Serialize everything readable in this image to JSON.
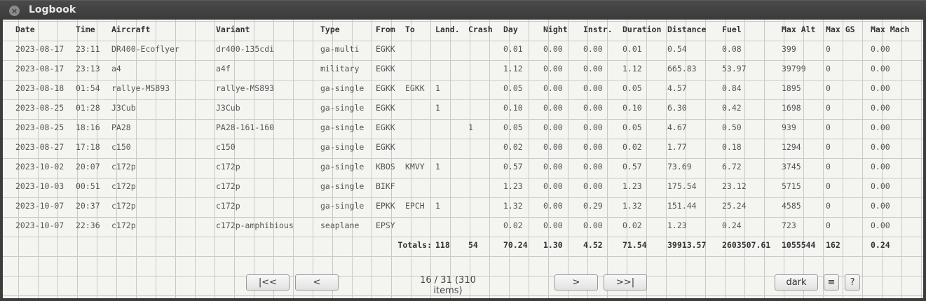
{
  "window": {
    "title": "Logbook"
  },
  "columns": [
    "Date",
    "Time",
    "Aircraft",
    "Variant",
    "Type",
    "From",
    "To",
    "Land.",
    "Crash",
    "Day",
    "Night",
    "Instr.",
    "Duration",
    "Distance",
    "Fuel",
    "Max Alt",
    "Max GS",
    "Max Mach"
  ],
  "rows": [
    [
      "2023-08-17",
      "23:11",
      "DR400-Ecoflyer",
      "dr400-135cdi",
      "ga-multi",
      "EGKK",
      "",
      "",
      "",
      "0.01",
      "0.00",
      "0.00",
      "0.01",
      "0.54",
      "0.08",
      "399",
      "0",
      "0.00"
    ],
    [
      "2023-08-17",
      "23:13",
      "a4",
      "a4f",
      "military",
      "EGKK",
      "",
      "",
      "",
      "1.12",
      "0.00",
      "0.00",
      "1.12",
      "665.83",
      "53.97",
      "39799",
      "0",
      "0.00"
    ],
    [
      "2023-08-18",
      "01:54",
      "rallye-MS893",
      "rallye-MS893",
      "ga-single",
      "EGKK",
      "EGKK",
      "1",
      "",
      "0.05",
      "0.00",
      "0.00",
      "0.05",
      "4.57",
      "0.84",
      "1895",
      "0",
      "0.00"
    ],
    [
      "2023-08-25",
      "01:28",
      "J3Cub",
      "J3Cub",
      "ga-single",
      "EGKK",
      "",
      "1",
      "",
      "0.10",
      "0.00",
      "0.00",
      "0.10",
      "6.30",
      "0.42",
      "1698",
      "0",
      "0.00"
    ],
    [
      "2023-08-25",
      "18:16",
      "PA28",
      "PA28-161-160",
      "ga-single",
      "EGKK",
      "",
      "",
      "1",
      "0.05",
      "0.00",
      "0.00",
      "0.05",
      "4.67",
      "0.50",
      "939",
      "0",
      "0.00"
    ],
    [
      "2023-08-27",
      "17:18",
      "c150",
      "c150",
      "ga-single",
      "EGKK",
      "",
      "",
      "",
      "0.02",
      "0.00",
      "0.00",
      "0.02",
      "1.77",
      "0.18",
      "1294",
      "0",
      "0.00"
    ],
    [
      "2023-10-02",
      "20:07",
      "c172p",
      "c172p",
      "ga-single",
      "KBOS",
      "KMVY",
      "1",
      "",
      "0.57",
      "0.00",
      "0.00",
      "0.57",
      "73.69",
      "6.72",
      "3745",
      "0",
      "0.00"
    ],
    [
      "2023-10-03",
      "00:51",
      "c172p",
      "c172p",
      "ga-single",
      "BIKF",
      "",
      "",
      "",
      "1.23",
      "0.00",
      "0.00",
      "1.23",
      "175.54",
      "23.12",
      "5715",
      "0",
      "0.00"
    ],
    [
      "2023-10-07",
      "20:37",
      "c172p",
      "c172p",
      "ga-single",
      "EPKK",
      "EPCH",
      "1",
      "",
      "1.32",
      "0.00",
      "0.29",
      "1.32",
      "151.44",
      "25.24",
      "4585",
      "0",
      "0.00"
    ],
    [
      "2023-10-07",
      "22:36",
      "c172p",
      "c172p-amphibious",
      "seaplane",
      "EPSY",
      "",
      "",
      "",
      "0.02",
      "0.00",
      "0.00",
      "0.02",
      "1.23",
      "0.24",
      "723",
      "0",
      "0.00"
    ]
  ],
  "totals": {
    "label": "Totals:",
    "land": "118",
    "crash": "54",
    "day": "70.24",
    "night": "1.30",
    "instr": "4.52",
    "duration": "71.54",
    "distance": "39913.57",
    "fuel": "2603507.61",
    "max_alt": "1055544",
    "max_gs": "162",
    "max_mach": "0.24"
  },
  "pager": {
    "first": "|<<",
    "prev": "<",
    "info": "16 / 31 (310 items)",
    "next": ">",
    "last": ">>|",
    "dark": "dark",
    "menu": "≡",
    "help": "?"
  }
}
